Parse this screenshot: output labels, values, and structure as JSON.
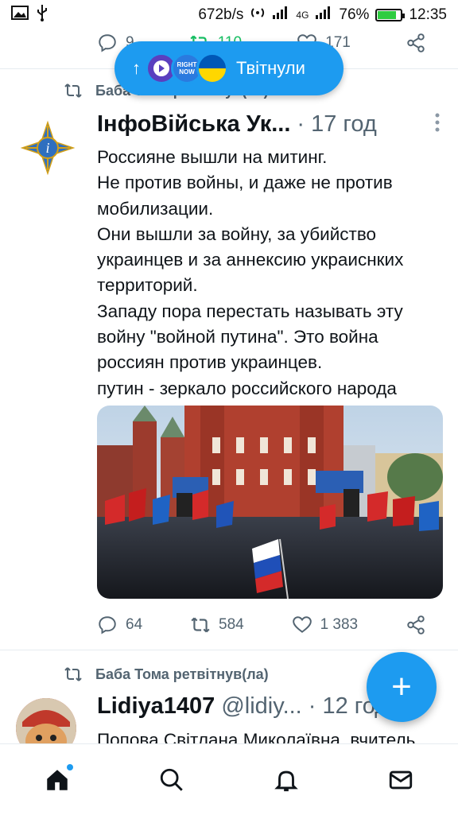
{
  "status_bar": {
    "speed": "672b/s",
    "network": "4G",
    "battery": "76%",
    "time": "12:35"
  },
  "top_tweet_actions": {
    "replies": "9",
    "retweets": "110",
    "likes": "171"
  },
  "new_tweets_pill": {
    "label": "Твітнули",
    "avatar2_text": "RIGHT NOW"
  },
  "tweet1": {
    "retweeted_by": "Баба Тома ретвітнув(ла)",
    "author_name": "ІнфоВійська Ук...",
    "time": "· 17 год",
    "text_lines": [
      "Россияне вышли на митинг.",
      "Не против войны, и даже не против",
      "мобилизации.",
      "Они вышли за войну, за убийство",
      "украинцев и за аннексию украиснких",
      "территорий.",
      "Западу пора перестать называть эту",
      "войну \"войной путина\". Это война",
      "россиян против украинцев.",
      "путин - зеркало российского народа"
    ],
    "replies": "64",
    "retweets": "584",
    "likes": "1 383"
  },
  "tweet2": {
    "retweeted_by": "Баба Тома ретвітнув(ла)",
    "author_name": "Lidiya1407",
    "handle": "@lidiy...",
    "time": "· 12 год",
    "text_preview": "Попова Світлана Миколаївна, вчитель"
  },
  "fab": {
    "label": "+"
  },
  "colors": {
    "accent": "#1d9bf0",
    "retweet_green": "#17bf63",
    "secondary_text": "#536471"
  }
}
